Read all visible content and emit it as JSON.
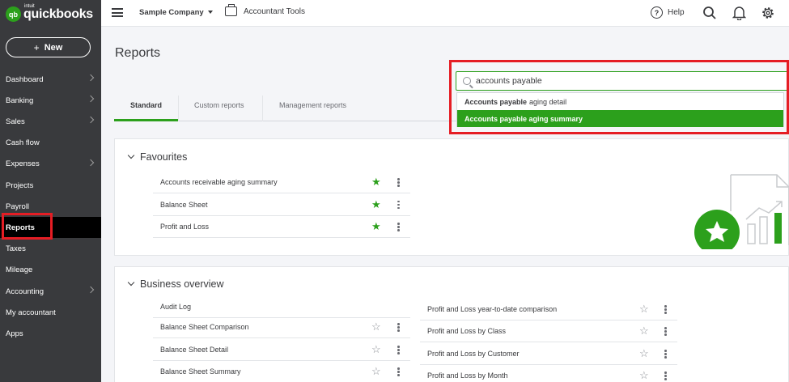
{
  "logo": {
    "mark": "qb",
    "intuit": "intuit",
    "name": "quickbooks"
  },
  "sidebar": {
    "new_label": "New",
    "items": [
      {
        "label": "Dashboard",
        "chevron": true
      },
      {
        "label": "Banking",
        "chevron": true
      },
      {
        "label": "Sales",
        "chevron": true
      },
      {
        "label": "Cash flow",
        "chevron": false
      },
      {
        "label": "Expenses",
        "chevron": true
      },
      {
        "label": "Projects",
        "chevron": false
      },
      {
        "label": "Payroll",
        "chevron": false
      },
      {
        "label": "Reports",
        "chevron": false,
        "active": true
      },
      {
        "label": "Taxes",
        "chevron": false
      },
      {
        "label": "Mileage",
        "chevron": false
      },
      {
        "label": "Accounting",
        "chevron": true
      },
      {
        "label": "My accountant",
        "chevron": false
      },
      {
        "label": "Apps",
        "chevron": false
      }
    ]
  },
  "topbar": {
    "company": "Sample Company",
    "accountant_tools": "Accountant Tools",
    "help": "Help",
    "help_glyph": "?",
    "icons": [
      "menu-icon",
      "briefcase-icon",
      "help-icon",
      "search-icon",
      "bell-icon",
      "gear-icon"
    ]
  },
  "page": {
    "title": "Reports"
  },
  "tabs": [
    "Standard",
    "Custom reports",
    "Management reports"
  ],
  "search": {
    "value": "accounts payable",
    "suggestions": [
      {
        "bold": "Accounts payable",
        "rest": "aging detail",
        "selected": false
      },
      {
        "bold": "Accounts payable aging summary",
        "rest": "",
        "selected": true
      }
    ]
  },
  "favourites": {
    "title": "Favourites",
    "items": [
      {
        "label": "Accounts receivable aging summary",
        "favourite": true
      },
      {
        "label": "Balance Sheet",
        "favourite": true
      },
      {
        "label": "Profit and Loss",
        "favourite": true
      }
    ]
  },
  "business_overview": {
    "title": "Business overview",
    "left": [
      {
        "label": "Audit Log",
        "favourite": null
      },
      {
        "label": "Balance Sheet Comparison",
        "favourite": false
      },
      {
        "label": "Balance Sheet Detail",
        "favourite": false
      },
      {
        "label": "Balance Sheet Summary",
        "favourite": false
      }
    ],
    "right": [
      {
        "label": "Profit and Loss year-to-date comparison",
        "favourite": false
      },
      {
        "label": "Profit and Loss by Class",
        "favourite": false
      },
      {
        "label": "Profit and Loss by Customer",
        "favourite": false
      },
      {
        "label": "Profit and Loss by Month",
        "favourite": false
      }
    ]
  },
  "colors": {
    "brand_green": "#2ca01c",
    "sidebar_bg": "#393a3d",
    "highlight_red": "#e51d24"
  }
}
